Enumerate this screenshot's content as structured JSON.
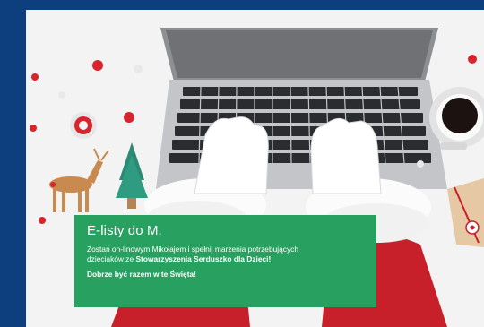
{
  "banner": {
    "title": "E-listy do M.",
    "body_line1": "Zostań on-linowym Mikołajem i spełnij marzenia potrzebujących",
    "body_line2_pre": "dzieciaków ze ",
    "body_line2_bold": "Stowarzyszenia Serduszko dla Dzieci!",
    "tagline": "Dobrze być razem w te Święta!"
  },
  "colors": {
    "frame": "#0d3f7f",
    "card": "#27a060",
    "santa_red": "#c8202b",
    "laptop": "#b7b9bd"
  },
  "icons": [
    "laptop-icon",
    "gloved-hands-icon",
    "coffee-cup-icon",
    "christmas-tree-icon",
    "deer-figurine-icon",
    "ornament-ball-icon",
    "gift-box-icon"
  ]
}
